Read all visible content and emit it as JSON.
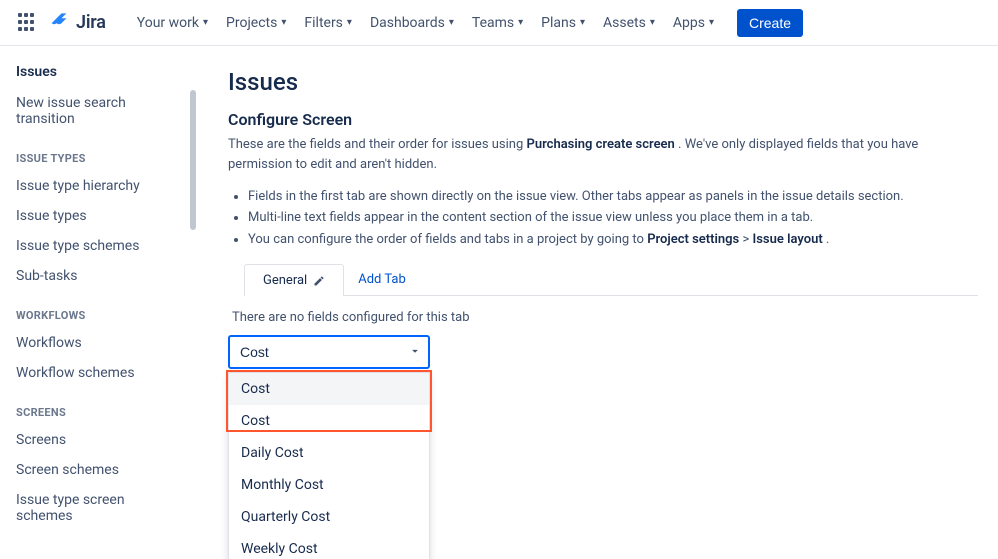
{
  "nav": {
    "logo_text": "Jira",
    "items": [
      "Your work",
      "Projects",
      "Filters",
      "Dashboards",
      "Teams",
      "Plans",
      "Assets",
      "Apps"
    ],
    "create": "Create"
  },
  "sidebar": {
    "title": "Issues",
    "top_link": "New issue search transition",
    "groups": [
      {
        "label": "Issue Types",
        "items": [
          "Issue type hierarchy",
          "Issue types",
          "Issue type schemes",
          "Sub-tasks"
        ]
      },
      {
        "label": "Workflows",
        "items": [
          "Workflows",
          "Workflow schemes"
        ]
      },
      {
        "label": "Screens",
        "items": [
          "Screens",
          "Screen schemes",
          "Issue type screen schemes"
        ]
      }
    ]
  },
  "main": {
    "title": "Issues",
    "subhead": "Configure Screen",
    "lead_pre": "These are the fields and their order for issues using ",
    "lead_bold": "Purchasing create screen",
    "lead_post": " . We've only displayed fields that you have permission to edit and aren't hidden.",
    "rules": [
      "Fields in the first tab are shown directly on the issue view. Other tabs appear as panels in the issue details section.",
      "Multi-line text fields appear in the content section of the issue view unless you place them in a tab."
    ],
    "rule3_pre": "You can configure the order of fields and tabs in a project by going to ",
    "rule3_b1": "Project settings",
    "rule3_sep": ">",
    "rule3_b2": "Issue layout",
    "rule3_post": " .",
    "tab_label": "General",
    "add_tab": "Add Tab",
    "empty": "There are no fields configured for this tab",
    "dd_value": "Cost",
    "dd_options": [
      "Cost",
      "Cost",
      "Daily Cost",
      "Monthly Cost",
      "Quarterly Cost",
      "Weekly Cost"
    ]
  }
}
